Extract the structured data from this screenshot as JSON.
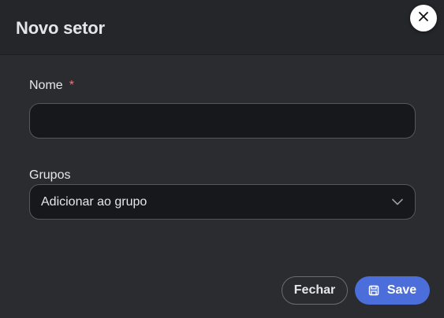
{
  "dialog": {
    "title": "Novo setor"
  },
  "form": {
    "name": {
      "label": "Nome",
      "required_mark": "*",
      "value": ""
    },
    "groups": {
      "label": "Grupos",
      "selected": "Adicionar ao grupo"
    }
  },
  "footer": {
    "close_label": "Fechar",
    "save_label": "Save"
  },
  "icons": {
    "close": "close-icon",
    "chevron": "chevron-down-icon",
    "save": "save-icon"
  },
  "colors": {
    "primary": "#4b6edb",
    "required": "#e07b7b"
  }
}
